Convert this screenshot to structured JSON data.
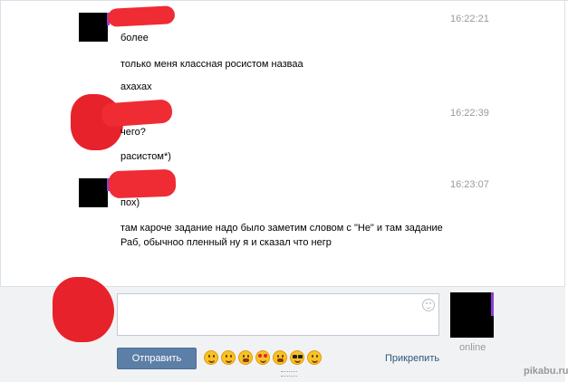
{
  "messages": [
    {
      "time": "16:22:21",
      "lines": [
        "более",
        "только меня классная росистом назваа",
        "ахахах"
      ]
    },
    {
      "time": "16:22:39",
      "lines": [
        "чего?",
        "расистом*)"
      ]
    },
    {
      "time": "16:23:07",
      "lines": [
        "пох)",
        "там кароче задание надо было заметим словом с \"Не\" и там задание",
        "Раб, обычноо пленный ну я и сказал что негр"
      ]
    }
  ],
  "composer": {
    "send_label": "Отправить",
    "attach_label": "Прикрепить",
    "online_label": "online",
    "emoji_icons": [
      "relieved-face-icon",
      "smiling-face-icon",
      "grinning-face-icon",
      "heart-eyes-face-icon",
      "weary-face-icon",
      "sunglasses-face-icon",
      "happy-face-icon"
    ]
  },
  "watermark": "pikabu.ru",
  "colors": {
    "redaction": "#e8222a",
    "send_button": "#5b7fa6",
    "link": "#2b587a",
    "time": "#999999",
    "purple_accent": "#8b3fd6"
  }
}
